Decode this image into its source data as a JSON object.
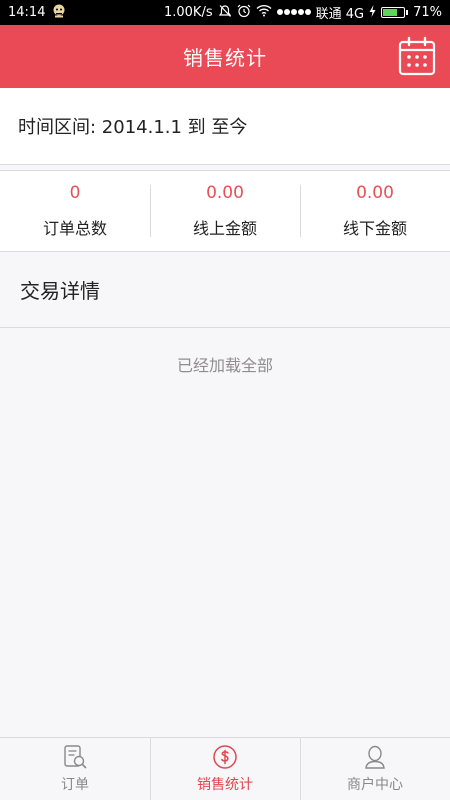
{
  "status_bar": {
    "time": "14:14",
    "network_speed": "1.00K/s",
    "carrier": "联通 4G",
    "battery_percent": "71%",
    "battery_level": 0.71,
    "icons": [
      "avatar-icon",
      "mute-icon",
      "alarm-icon",
      "wifi-icon",
      "signal-icon",
      "charging-icon",
      "battery-icon"
    ]
  },
  "header": {
    "title": "销售统计",
    "calendar_icon": "calendar-icon"
  },
  "time_range": {
    "text": "时间区间: 2014.1.1 到 至今"
  },
  "stats": [
    {
      "value": "0",
      "label": "订单总数"
    },
    {
      "value": "0.00",
      "label": "线上金额"
    },
    {
      "value": "0.00",
      "label": "线下金额"
    }
  ],
  "details": {
    "title": "交易详情",
    "empty_message": "已经加载全部"
  },
  "bottom_nav": [
    {
      "label": "订单",
      "icon": "order-search-icon",
      "active": false
    },
    {
      "label": "销售统计",
      "icon": "dollar-circle-icon",
      "active": true
    },
    {
      "label": "商户中心",
      "icon": "user-icon",
      "active": false
    }
  ],
  "colors": {
    "accent": "#ea4a55",
    "value_red": "#e65159",
    "inactive_gray": "#8a888d",
    "background": "#f7f6f8"
  }
}
